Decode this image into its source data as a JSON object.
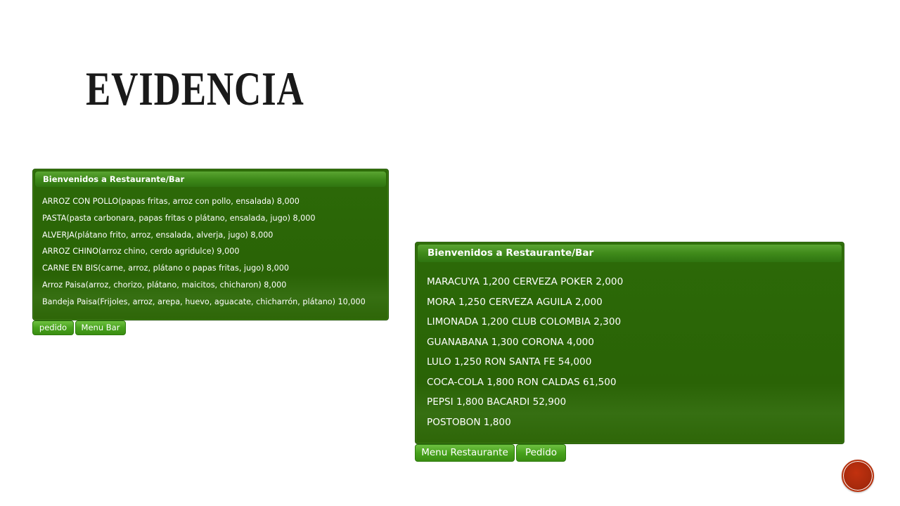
{
  "slide": {
    "title": "EVIDENCIA"
  },
  "panel_left": {
    "header": "Bienvenidos a Restaurante/Bar",
    "items": [
      "ARROZ CON POLLO(papas fritas, arroz con pollo, ensalada) 8,000",
      "PASTA(pasta carbonara, papas fritas o plátano, ensalada, jugo) 8,000",
      "ALVERJA(plátano frito, arroz, ensalada, alverja, jugo) 8,000",
      "ARROZ CHINO(arroz chino, cerdo agridulce) 9,000",
      "CARNE EN BIS(carne, arroz, plátano o papas fritas, jugo) 8,000",
      "Arroz Paisa(arroz, chorizo, plátano, maicitos, chicharon) 8,000",
      "Bandeja Paisa(Frijoles, arroz, arepa, huevo, aguacate, chicharrón, plátano) 10,000"
    ],
    "buttons": {
      "pedido": "pedido",
      "menu_bar": "Menu Bar"
    }
  },
  "panel_right": {
    "header": "Bienvenidos a Restaurante/Bar",
    "items": [
      "MARACUYA 1,200 CERVEZA POKER 2,000",
      "MORA 1,250 CERVEZA AGUILA 2,000",
      "LIMONADA 1,200 CLUB COLOMBIA 2,300",
      "GUANABANA 1,300 CORONA 4,000",
      "LULO 1,250 RON SANTA FE 54,000",
      "COCA-COLA 1,800 RON CALDAS 61,500",
      "PEPSI 1,800 BACARDI 52,900",
      "POSTOBON 1,800"
    ],
    "buttons": {
      "menu_restaurante": "Menu Restaurante",
      "pedido": "Pedido"
    }
  },
  "colors": {
    "panel": "#2c6a08",
    "header": "#3f8a1a",
    "button": "#47a21c",
    "nav": "#b83410"
  },
  "icons": {
    "nav": "next-slide-circle-icon"
  }
}
